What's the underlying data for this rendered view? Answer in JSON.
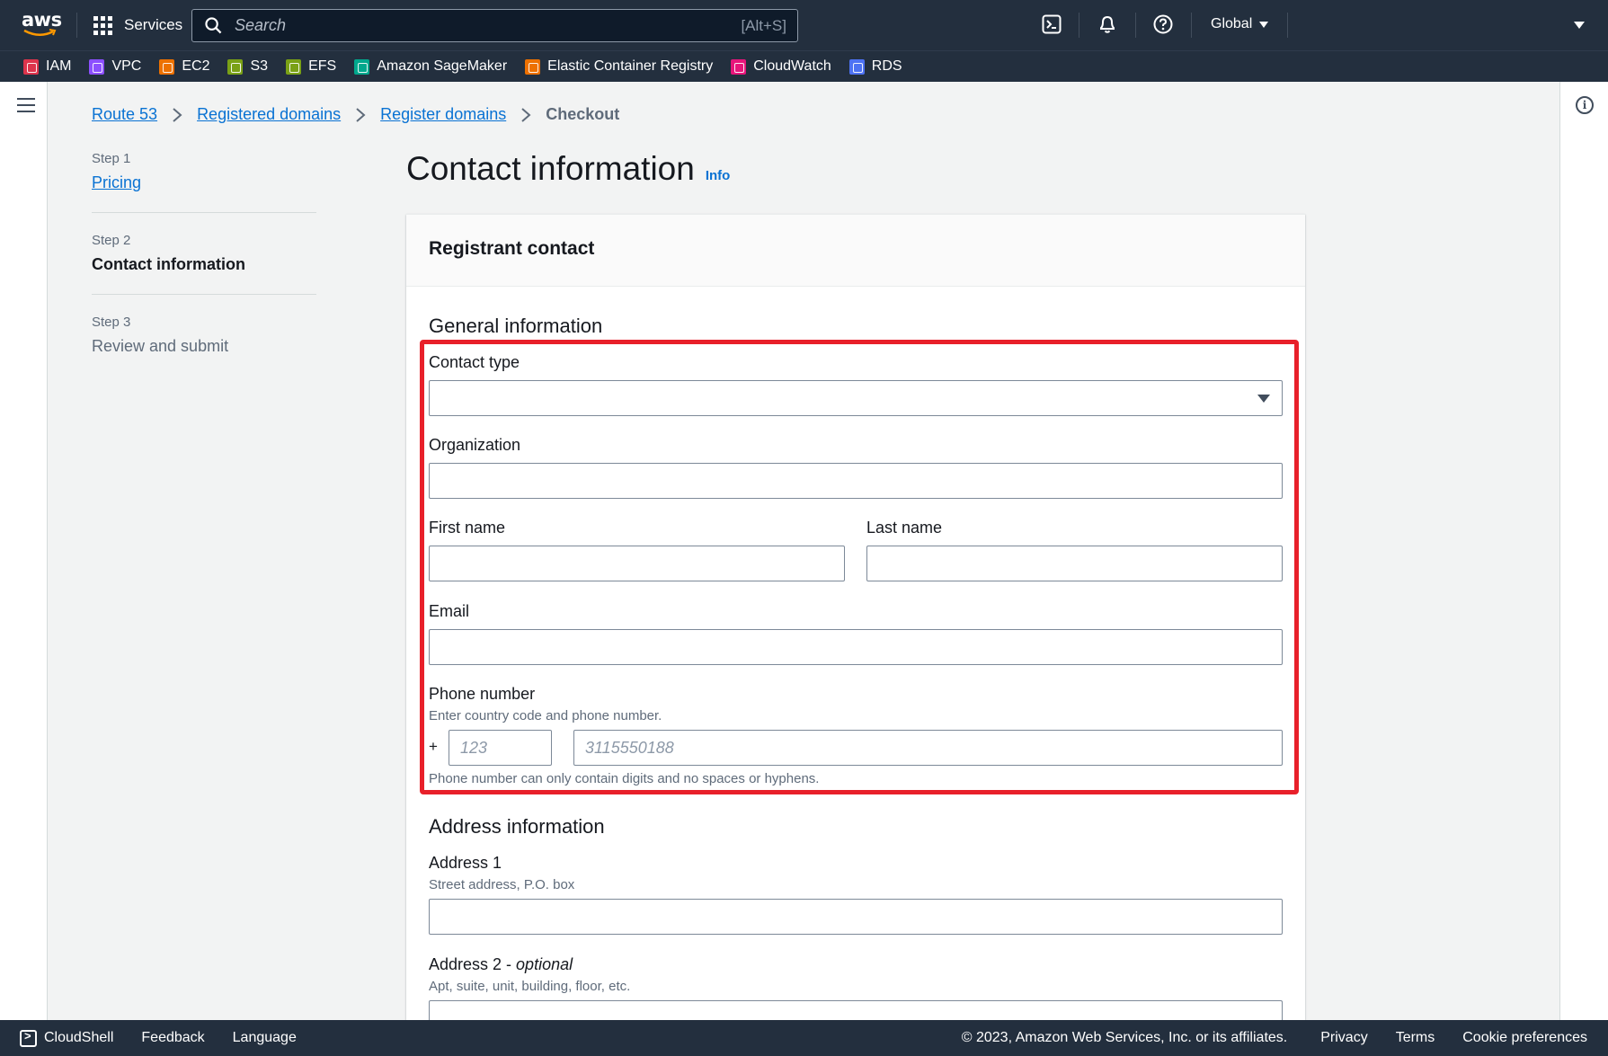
{
  "topnav": {
    "logo_text": "aws",
    "services_label": "Services",
    "search_placeholder": "Search",
    "search_shortcut": "[Alt+S]",
    "region_label": "Global"
  },
  "favorites": [
    {
      "label": "IAM",
      "color": "#dd344c"
    },
    {
      "label": "VPC",
      "color": "#8c4fff"
    },
    {
      "label": "EC2",
      "color": "#ed7100"
    },
    {
      "label": "S3",
      "color": "#7aa116"
    },
    {
      "label": "EFS",
      "color": "#7aa116"
    },
    {
      "label": "Amazon SageMaker",
      "color": "#01a88d"
    },
    {
      "label": "Elastic Container Registry",
      "color": "#ed7100"
    },
    {
      "label": "CloudWatch",
      "color": "#e7157b"
    },
    {
      "label": "RDS",
      "color": "#4d72f3"
    }
  ],
  "breadcrumb": {
    "items": [
      "Route 53",
      "Registered domains",
      "Register domains"
    ],
    "current": "Checkout"
  },
  "steps": [
    {
      "num": "Step 1",
      "label": "Pricing"
    },
    {
      "num": "Step 2",
      "label": "Contact information"
    },
    {
      "num": "Step 3",
      "label": "Review and submit"
    }
  ],
  "page": {
    "title": "Contact information",
    "info_link": "Info"
  },
  "card": {
    "header": "Registrant contact",
    "general_title": "General information",
    "contact_type_label": "Contact type",
    "contact_type_value": "",
    "organization_label": "Organization",
    "first_name_label": "First name",
    "last_name_label": "Last name",
    "email_label": "Email",
    "phone_label": "Phone number",
    "phone_desc": "Enter country code and phone number.",
    "plus_sign": "+",
    "country_code_placeholder": "123",
    "phone_placeholder": "3115550188",
    "phone_hint": "Phone number can only contain digits and no spaces or hyphens.",
    "address_title": "Address information",
    "address1_label": "Address 1",
    "address1_desc": "Street address, P.O. box",
    "address2_label": "Address 2 - ",
    "address2_optional": "optional",
    "address2_desc": "Apt, suite, unit, building, floor, etc."
  },
  "footer": {
    "cloudshell": "CloudShell",
    "feedback": "Feedback",
    "language": "Language",
    "copyright": "© 2023, Amazon Web Services, Inc. or its affiliates.",
    "privacy": "Privacy",
    "terms": "Terms",
    "cookie": "Cookie preferences"
  },
  "colors": {
    "nav_bg": "#232f3e",
    "link": "#0972d3",
    "highlight": "#e8202a"
  }
}
